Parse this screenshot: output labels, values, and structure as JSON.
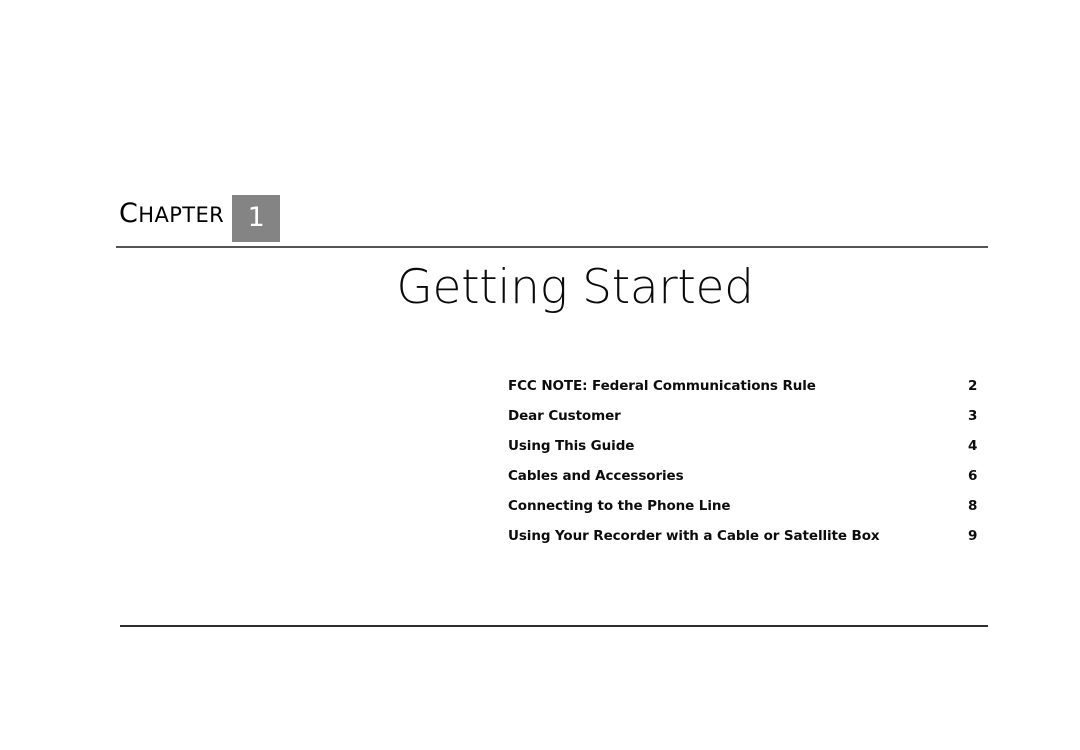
{
  "page": {
    "background_color": "#ffffff"
  },
  "chapter_header": {
    "label_first_letter": "C",
    "label_rest": "HAPTER",
    "label_full": "CHAPTER",
    "number": "1",
    "number_box_color": "#848484",
    "number_text_color": "#ffffff"
  },
  "rules": {
    "top_color": "#555555",
    "bottom_color": "#2e2e2e"
  },
  "title": {
    "text": "Getting Started",
    "color": "#0a0a0a"
  },
  "toc": {
    "entries": [
      {
        "label": "FCC NOTE: Federal Communications Rule",
        "page": "2"
      },
      {
        "label": "Dear Customer",
        "page": "3"
      },
      {
        "label": "Using This Guide",
        "page": "4"
      },
      {
        "label": "Cables and Accessories",
        "page": "6"
      },
      {
        "label": "Connecting to the Phone Line",
        "page": "8"
      },
      {
        "label": "Using Your Recorder with a Cable or Satellite Box",
        "page": "9"
      }
    ]
  }
}
